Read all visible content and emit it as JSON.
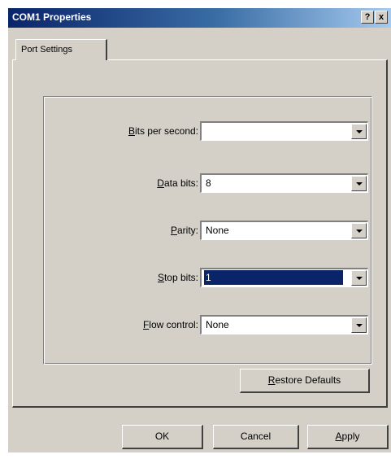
{
  "window": {
    "title": "COM1 Properties",
    "help_glyph": "?",
    "close_glyph": "x"
  },
  "tabs": [
    {
      "label": "Port Settings"
    }
  ],
  "settings": [
    {
      "label_mnemonic": "B",
      "label_rest": "its per second:",
      "value": "",
      "selected": false
    },
    {
      "label_mnemonic": "D",
      "label_rest": "ata bits:",
      "value": "8",
      "selected": false
    },
    {
      "label_mnemonic": "P",
      "label_rest": "arity:",
      "value": "None",
      "selected": false
    },
    {
      "label_mnemonic": "S",
      "label_rest": "top bits:",
      "value": "1",
      "selected": true
    },
    {
      "label_mnemonic": "F",
      "label_rest": "low control:",
      "value": "None",
      "selected": false
    }
  ],
  "buttons": {
    "restore_mnemonic": "R",
    "restore_rest": "estore Defaults",
    "ok": "OK",
    "cancel": "Cancel",
    "apply_mnemonic": "A",
    "apply_rest": "pply"
  },
  "colors": {
    "title_bar": "#0a246a",
    "face": "#d4d0c8",
    "selection": "#0a246a"
  }
}
